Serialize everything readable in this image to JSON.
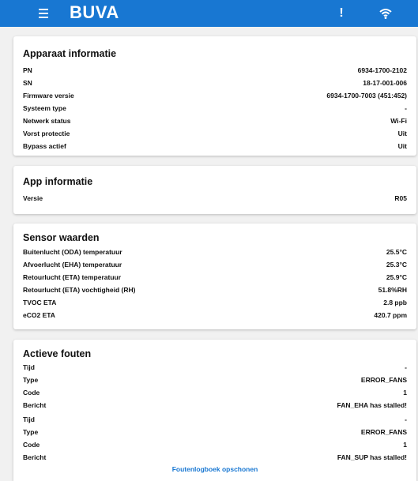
{
  "header": {
    "logo": "BUVA",
    "alert_label": "!"
  },
  "apparaat": {
    "title": "Apparaat informatie",
    "rows": [
      {
        "label": "PN",
        "value": "6934-1700-2102"
      },
      {
        "label": "SN",
        "value": "18-17-001-006"
      },
      {
        "label": "Firmware versie",
        "value": "6934-1700-7003 (451:452)"
      },
      {
        "label": "Systeem type",
        "value": "-"
      },
      {
        "label": "Netwerk status",
        "value": "Wi-Fi"
      },
      {
        "label": "Vorst protectie",
        "value": "Uit"
      },
      {
        "label": "Bypass actief",
        "value": "Uit"
      }
    ]
  },
  "app": {
    "title": "App informatie",
    "rows": [
      {
        "label": "Versie",
        "value": "R05"
      }
    ]
  },
  "sensor": {
    "title": "Sensor waarden",
    "rows": [
      {
        "label": "Buitenlucht (ODA) temperatuur",
        "value": "25.5°C"
      },
      {
        "label": "Afvoerlucht (EHA) temperatuur",
        "value": "25.3°C"
      },
      {
        "label": "Retourlucht (ETA) temperatuur",
        "value": "25.9°C"
      },
      {
        "label": "Retourlucht (ETA) vochtigheid (RH)",
        "value": "51.8%RH"
      },
      {
        "label": "TVOC ETA",
        "value": "2.8 ppb"
      },
      {
        "label": "eCO2 ETA",
        "value": "420.7 ppm"
      }
    ]
  },
  "fouten": {
    "title": "Actieve fouten",
    "rows": [
      {
        "label": "Tijd",
        "value": "-"
      },
      {
        "label": "Type",
        "value": "ERROR_FANS"
      },
      {
        "label": "Code",
        "value": "1"
      },
      {
        "label": "Bericht",
        "value": "FAN_EHA has stalled!"
      },
      {
        "label": "Tijd",
        "value": "-"
      },
      {
        "label": "Type",
        "value": "ERROR_FANS"
      },
      {
        "label": "Code",
        "value": "1"
      },
      {
        "label": "Bericht",
        "value": "FAN_SUP has stalled!"
      }
    ],
    "action_label": "Foutenlogboek opschonen"
  }
}
